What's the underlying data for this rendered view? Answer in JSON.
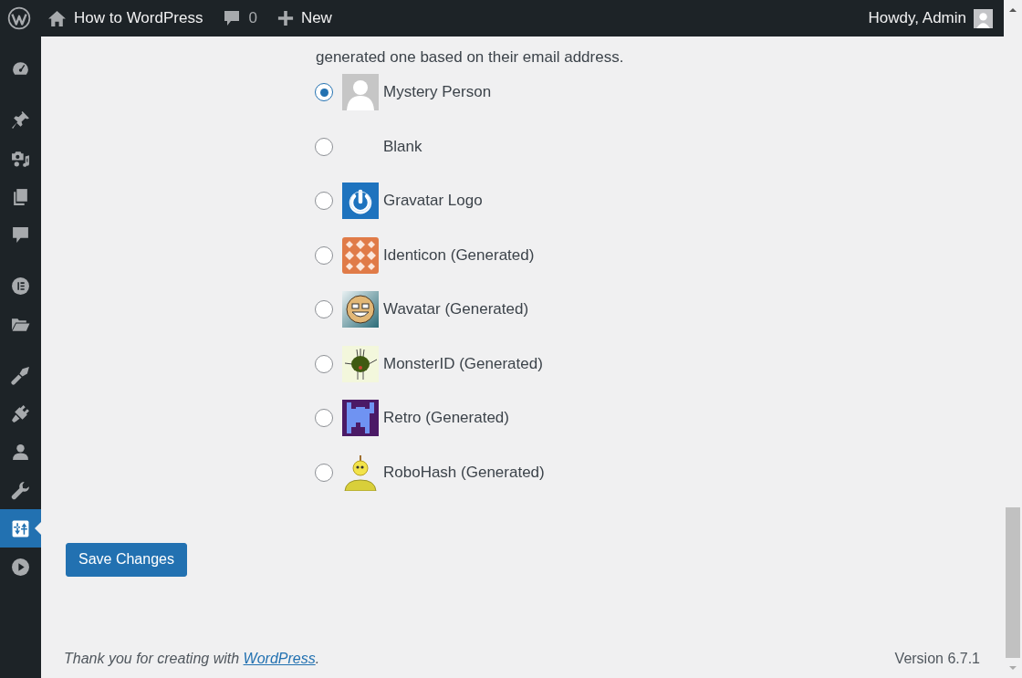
{
  "admin_bar": {
    "site_name": "How to WordPress",
    "comments_count": "0",
    "new_label": "New",
    "greeting": "Howdy, Admin"
  },
  "sidebar": {
    "groups": [
      {
        "items": [
          {
            "kind": "dashboard",
            "selected": false
          }
        ]
      },
      {
        "items": [
          {
            "kind": "posts",
            "selected": false
          },
          {
            "kind": "media",
            "selected": false
          },
          {
            "kind": "pages",
            "selected": false
          },
          {
            "kind": "comments",
            "selected": false
          }
        ]
      },
      {
        "items": [
          {
            "kind": "elementor",
            "selected": false
          },
          {
            "kind": "templates",
            "selected": false
          }
        ]
      },
      {
        "items": [
          {
            "kind": "appearance",
            "selected": false
          },
          {
            "kind": "plugins",
            "selected": false
          },
          {
            "kind": "users",
            "selected": false
          },
          {
            "kind": "tools",
            "selected": false
          },
          {
            "kind": "settings",
            "selected": true
          },
          {
            "kind": "media_player",
            "selected": false
          }
        ]
      }
    ]
  },
  "default_avatar": {
    "description_tail": "generated one based on their email address.",
    "options": [
      {
        "kind": "mystery",
        "label": "Mystery Person",
        "selected": true
      },
      {
        "kind": "blank",
        "label": "Blank",
        "selected": false
      },
      {
        "kind": "gravatar",
        "label": "Gravatar Logo",
        "selected": false
      },
      {
        "kind": "identicon",
        "label": "Identicon (Generated)",
        "selected": false
      },
      {
        "kind": "wavatar",
        "label": "Wavatar (Generated)",
        "selected": false
      },
      {
        "kind": "monsterid",
        "label": "MonsterID (Generated)",
        "selected": false
      },
      {
        "kind": "retro",
        "label": "Retro (Generated)",
        "selected": false
      },
      {
        "kind": "robohash",
        "label": "RoboHash (Generated)",
        "selected": false
      }
    ]
  },
  "save_button": "Save Changes",
  "footer": {
    "thanks_text": "Thank you for creating with ",
    "link": "WordPress",
    "thanks_end": ".",
    "version": "Version 6.7.1"
  }
}
